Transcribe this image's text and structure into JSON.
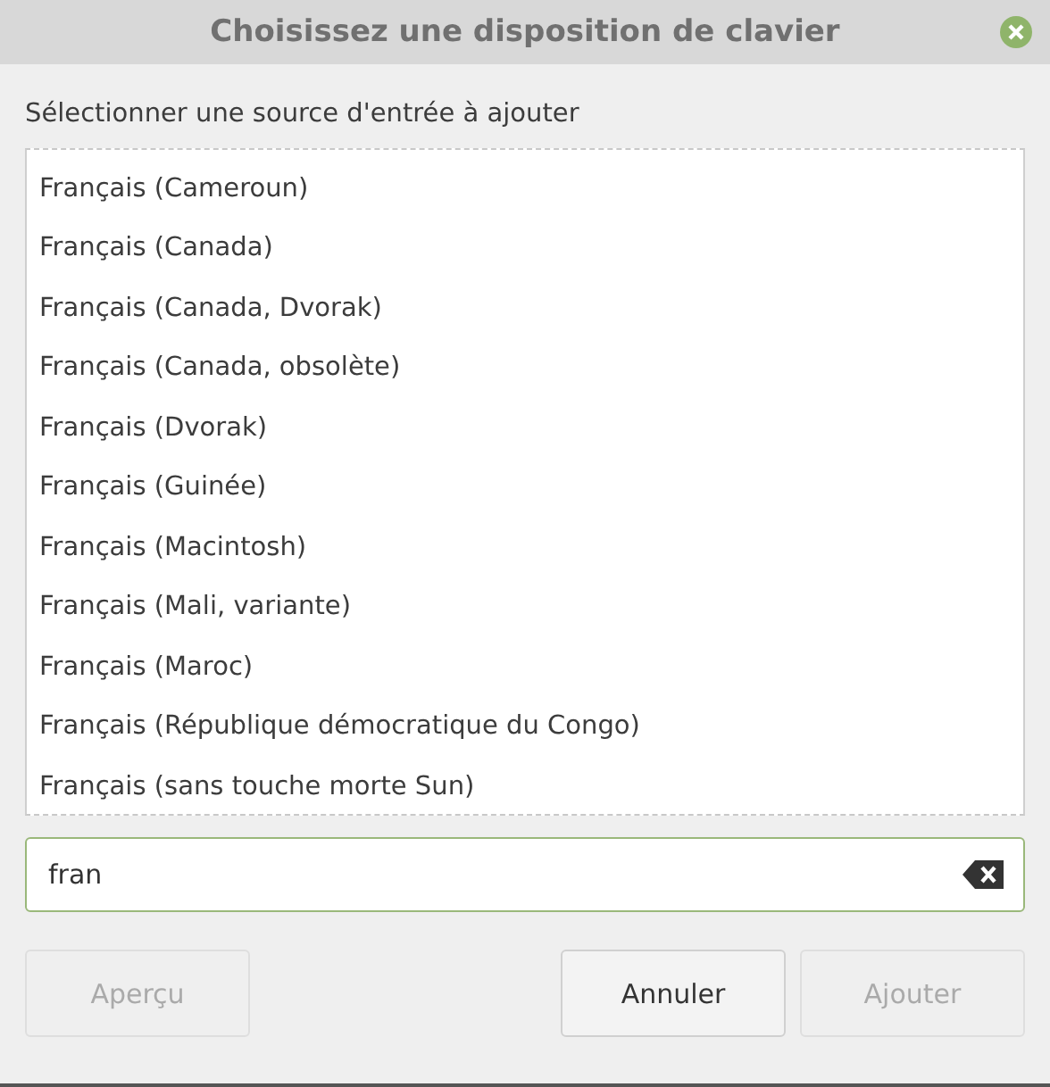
{
  "window": {
    "title": "Choisissez une disposition de clavier"
  },
  "prompt": "Sélectionner une source d'entrée à ajouter",
  "layouts": [
    {
      "label": "Français (Cameroun)",
      "selected": false
    },
    {
      "label": "Français (Canada)",
      "selected": false
    },
    {
      "label": "Français (Canada, Dvorak)",
      "selected": false
    },
    {
      "label": "Français (Canada, obsolète)",
      "selected": false
    },
    {
      "label": "Français (Dvorak)",
      "selected": false
    },
    {
      "label": "Français (Guinée)",
      "selected": false
    },
    {
      "label": "Français (Macintosh)",
      "selected": false
    },
    {
      "label": "Français (Mali, variante)",
      "selected": false
    },
    {
      "label": "Français (Maroc)",
      "selected": false
    },
    {
      "label": "Français (République démocratique du Congo)",
      "selected": false
    },
    {
      "label": "Français (sans touche morte Sun)",
      "selected": false
    }
  ],
  "search": {
    "value": "fran"
  },
  "buttons": [
    {
      "label": "Aperçu",
      "disabled": true
    },
    {
      "label": "Annuler",
      "disabled": false
    },
    {
      "label": "Ajouter",
      "disabled": true
    }
  ]
}
